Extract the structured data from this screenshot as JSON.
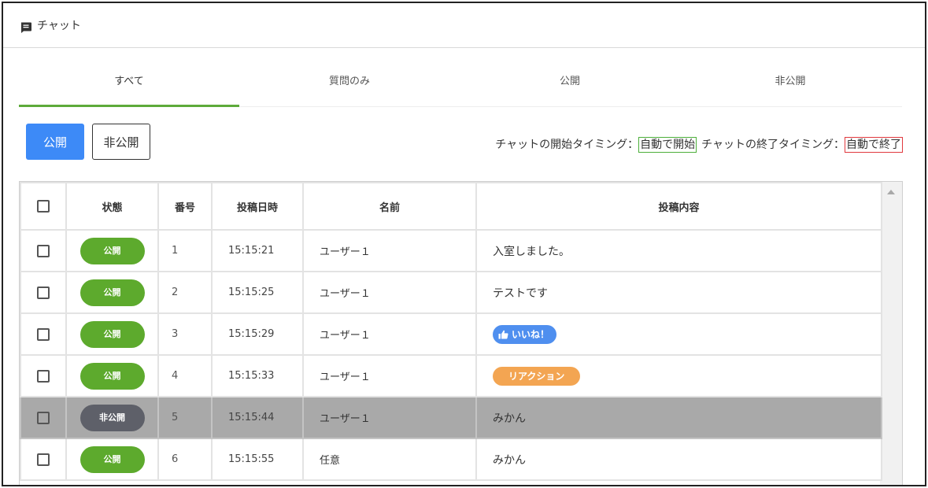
{
  "header": {
    "title": "チャット",
    "icon": "chat-icon"
  },
  "tabs": [
    {
      "label": "すべて",
      "active": true
    },
    {
      "label": "質問のみ",
      "active": false
    },
    {
      "label": "公開",
      "active": false
    },
    {
      "label": "非公開",
      "active": false
    }
  ],
  "actions": {
    "public_label": "公開",
    "private_label": "非公開"
  },
  "timing": {
    "start_label": "チャットの開始タイミング：",
    "start_value": "自動で開始",
    "end_label": "チャットの終了タイミング：",
    "end_value": "自動で終了"
  },
  "table": {
    "columns": {
      "state": "状態",
      "number": "番号",
      "time": "投稿日時",
      "name": "名前",
      "content": "投稿内容"
    },
    "rows": [
      {
        "state": "公開",
        "number": "1",
        "time": "15:15:21",
        "name": "ユーザー１",
        "content": "入室しました。",
        "type": "text",
        "private": false
      },
      {
        "state": "公開",
        "number": "2",
        "time": "15:15:25",
        "name": "ユーザー１",
        "content": "テストです",
        "type": "text",
        "private": false
      },
      {
        "state": "公開",
        "number": "3",
        "time": "15:15:29",
        "name": "ユーザー１",
        "content": "いいね！",
        "type": "like",
        "private": false
      },
      {
        "state": "公開",
        "number": "4",
        "time": "15:15:33",
        "name": "ユーザー１",
        "content": "リアクション",
        "type": "reaction",
        "private": false
      },
      {
        "state": "非公開",
        "number": "5",
        "time": "15:15:44",
        "name": "ユーザー１",
        "content": "みかん",
        "type": "text",
        "private": true
      },
      {
        "state": "公開",
        "number": "6",
        "time": "15:15:55",
        "name": "任意",
        "content": "みかん",
        "type": "text",
        "private": false
      }
    ]
  },
  "colors": {
    "tab_active": "#5daa3a",
    "primary": "#3d8af7",
    "status_public": "#5daa2d",
    "status_private": "#5e6069",
    "like_badge": "#4f8fef",
    "reaction_badge": "#f3a552",
    "start_box": "#4caf3a",
    "end_box": "#e0393e"
  }
}
